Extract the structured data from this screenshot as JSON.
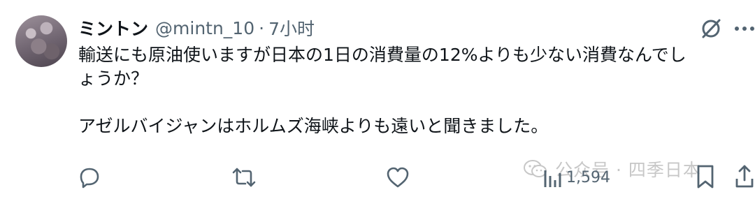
{
  "tweet": {
    "author_name": "ミントン",
    "author_handle": "@mintn_10",
    "separator": "·",
    "timestamp": "7小时",
    "text_line1": "輸送にも原油使いますが日本の1日の消費量の12%よりも少ない消費なんでし",
    "text_line2": "ょうか？",
    "text_line3": "アゼルバイジャンはホルムズ海峡よりも遠いと聞きました。"
  },
  "header_icons": {
    "grok": "grok-icon",
    "more": "more-icon"
  },
  "actions": {
    "reply": {
      "icon": "reply-icon"
    },
    "retweet": {
      "icon": "retweet-icon"
    },
    "like": {
      "icon": "heart-icon"
    },
    "views": {
      "icon": "views-icon",
      "count": "1,594"
    },
    "bookmark": {
      "icon": "bookmark-icon"
    },
    "share": {
      "icon": "share-icon"
    }
  },
  "watermark": {
    "text": "公众号 · 四季日本"
  },
  "colors": {
    "primary_text": "#0f1419",
    "secondary_text": "#536471",
    "background": "#ffffff"
  }
}
